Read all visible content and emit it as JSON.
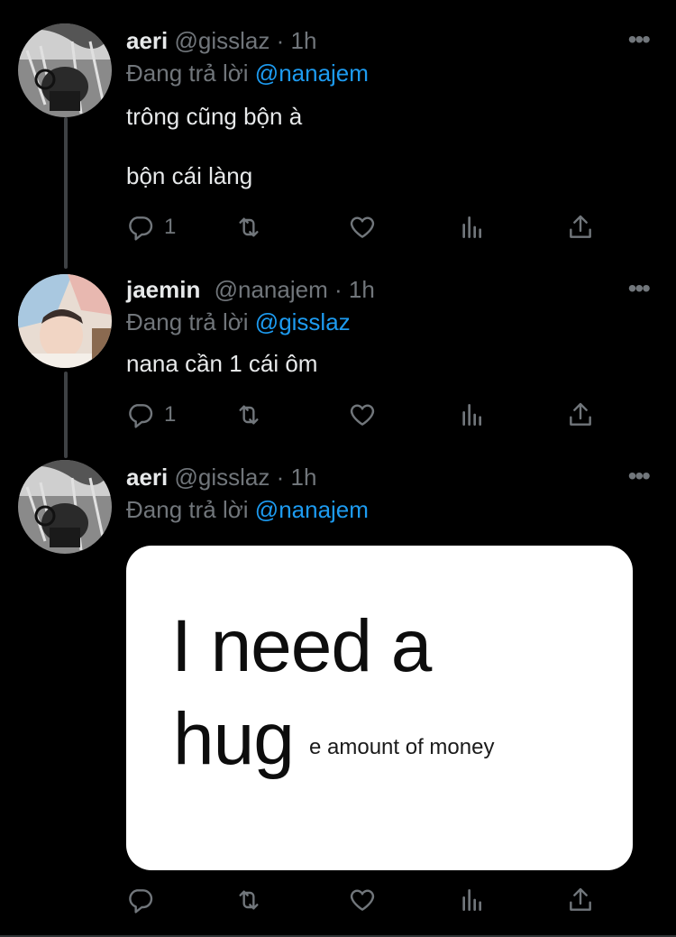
{
  "tweets": [
    {
      "name": "aeri",
      "handle": "@gisslaz",
      "dot": "·",
      "time": "1h",
      "reply_prefix": "Đang trả lời",
      "reply_to": "@nanajem",
      "text_lines": [
        "trông cũng bộn à",
        "bộn cái làng"
      ],
      "reply_count": "1"
    },
    {
      "name": "jaemin",
      "handle": "@nanajem",
      "dot": "·",
      "time": "1h",
      "reply_prefix": "Đang trả lời",
      "reply_to": "@gisslaz",
      "text_lines": [
        "nana cần 1 cái ôm"
      ],
      "reply_count": "1"
    },
    {
      "name": "aeri",
      "handle": "@gisslaz",
      "dot": "·",
      "time": "1h",
      "reply_prefix": "Đang trả lời",
      "reply_to": "@nanajem",
      "media": {
        "line1": "I need a",
        "line2": "hug",
        "line2_small": "e amount of money"
      },
      "reply_count": ""
    }
  ],
  "icons": {
    "more": "more-horizontal-icon",
    "reply": "reply-icon",
    "retweet": "retweet-icon",
    "like": "heart-icon",
    "views": "views-icon",
    "share": "share-icon"
  },
  "colors": {
    "background": "#000000",
    "text": "#e7e9ea",
    "muted": "#71767b",
    "link": "#1d9bf0"
  }
}
